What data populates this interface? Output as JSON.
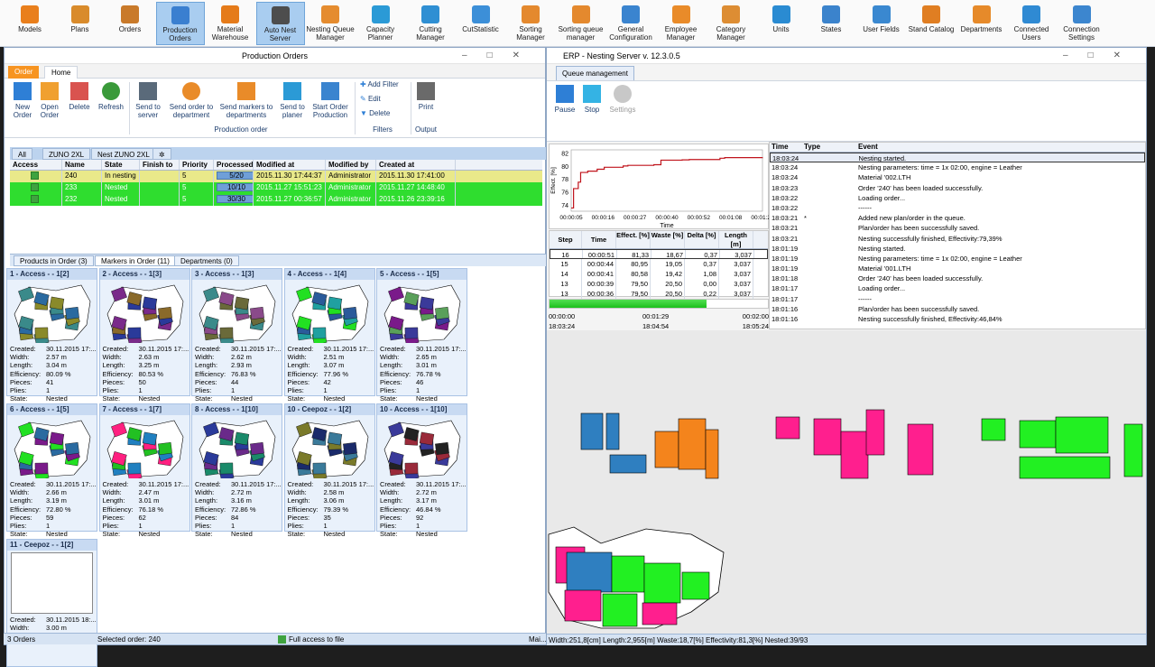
{
  "toolbar": {
    "items": [
      {
        "label": "Models",
        "color": "#e97f1c"
      },
      {
        "label": "Plans",
        "color": "#d98b2b"
      },
      {
        "label": "Orders",
        "color": "#c97a2a"
      },
      {
        "label": "Production Orders",
        "color": "#3a7fd0",
        "active": true
      },
      {
        "label": "Material Warehouse",
        "color": "#e57b1a"
      },
      {
        "label": "Auto Nest Server",
        "color": "#4d4d4d",
        "active": true
      },
      {
        "label": "Nesting Queue Manager",
        "color": "#e58c2f"
      },
      {
        "label": "Capacity Planner",
        "color": "#2b9ad6"
      },
      {
        "label": "Cutting Manager",
        "color": "#2f8fd3"
      },
      {
        "label": "CutStatistic",
        "color": "#3c8fd8"
      },
      {
        "label": "Sorting Manager",
        "color": "#e4892e"
      },
      {
        "label": "Sorting queue manager",
        "color": "#e4892e"
      },
      {
        "label": "General Configuration",
        "color": "#3a84cf"
      },
      {
        "label": "Employee Manager",
        "color": "#e98b29"
      },
      {
        "label": "Category Manager",
        "color": "#dd8d33"
      },
      {
        "label": "Units",
        "color": "#2a8bd2"
      },
      {
        "label": "States",
        "color": "#3b83cc"
      },
      {
        "label": "User Fields",
        "color": "#3a88d0"
      },
      {
        "label": "Stand Catalog",
        "color": "#e07e22"
      },
      {
        "label": "Departments",
        "color": "#e68a2a"
      },
      {
        "label": "Connected Users",
        "color": "#2f8ad3"
      },
      {
        "label": "Connection Settings",
        "color": "#3c86cf"
      }
    ]
  },
  "win1": {
    "title": "Production Orders",
    "tab_order": "Order",
    "tab_home": "Home",
    "ribbon": {
      "new": "New Order",
      "open": "Open Order",
      "delete": "Delete",
      "refresh": "Refresh",
      "send_server": "Send to server",
      "send_dept": "Send order to department",
      "send_markers": "Send markers to departments",
      "send_planer": "Send to planer",
      "start": "Start Order Production",
      "group_po": "Production order",
      "add_filter": "Add Filter",
      "edit": "Edit",
      "delete_f": "Delete",
      "group_filters": "Filters",
      "print": "Print",
      "group_output": "Output"
    },
    "grid_tabs": [
      "All",
      "ZUNO 2XL",
      "Nest ZUNO 2XL"
    ],
    "headers": [
      "Access",
      "Name",
      "State",
      "Finish to",
      "Priority",
      "Processed",
      "Modified at",
      "Modified by",
      "Created at"
    ],
    "rows": [
      {
        "name": "240",
        "state": "In nesting",
        "finish": "",
        "priority": "5",
        "processed": "5/20",
        "modified": "2015.11.30 17:44:37",
        "by": "Administrator",
        "created": "2015.11.30 17:41:00",
        "style": "sel"
      },
      {
        "name": "233",
        "state": "Nested",
        "finish": "",
        "priority": "5",
        "processed": "10/10",
        "modified": "2015.11.27 15:51:23",
        "by": "Administrator",
        "created": "2015.11.27 14:48:40",
        "style": "green"
      },
      {
        "name": "232",
        "state": "Nested",
        "finish": "",
        "priority": "5",
        "processed": "30/30",
        "modified": "2015.11.27 00:36:57",
        "by": "Administrator",
        "created": "2015.11.26 23:39:16",
        "style": "green"
      }
    ],
    "sub_tabs": [
      "Products in Order (3)",
      "Markers in Order (11)",
      "Departments (0)"
    ],
    "meta_labels": [
      "Created:",
      "Width:",
      "Length:",
      "Efficiency:",
      "Pieces:",
      "Plies:",
      "State:"
    ],
    "cards": [
      {
        "title": "1 - Access -  - 1[2]",
        "created": "30.11.2015 17:...",
        "width": "2.57 m",
        "length": "3.04 m",
        "eff": "80.09 %",
        "pieces": "41",
        "plies": "1",
        "state": "Nested"
      },
      {
        "title": "2 - Access -  - 1[3]",
        "created": "30.11.2015 17:...",
        "width": "2.63 m",
        "length": "3.25 m",
        "eff": "80.53 %",
        "pieces": "50",
        "plies": "1",
        "state": "Nested"
      },
      {
        "title": "3 - Access -  - 1[3]",
        "created": "30.11.2015 17:...",
        "width": "2.62 m",
        "length": "2.93 m",
        "eff": "76.83 %",
        "pieces": "44",
        "plies": "1",
        "state": "Nested"
      },
      {
        "title": "4 - Access -  - 1[4]",
        "created": "30.11.2015 17:...",
        "width": "2.51 m",
        "length": "3.07 m",
        "eff": "77.96 %",
        "pieces": "42",
        "plies": "1",
        "state": "Nested"
      },
      {
        "title": "5 - Access -  - 1[5]",
        "created": "30.11.2015 17:...",
        "width": "2.65 m",
        "length": "3.01 m",
        "eff": "76.78 %",
        "pieces": "46",
        "plies": "1",
        "state": "Nested"
      },
      {
        "title": "6 - Access -  - 1[5]",
        "created": "30.11.2015 17:...",
        "width": "2.66 m",
        "length": "3.19 m",
        "eff": "72.80 %",
        "pieces": "59",
        "plies": "1",
        "state": "Nested"
      },
      {
        "title": "7 - Access -  - 1[7]",
        "created": "30.11.2015 17:...",
        "width": "2.47 m",
        "length": "3.01 m",
        "eff": "76.18 %",
        "pieces": "62",
        "plies": "1",
        "state": "Nested"
      },
      {
        "title": "8 - Access -  - 1[10]",
        "created": "30.11.2015 17:...",
        "width": "2.72 m",
        "length": "3.16 m",
        "eff": "72.86 %",
        "pieces": "84",
        "plies": "1",
        "state": "Nested"
      },
      {
        "title": "10 - Ceepoz -  - 1[2]",
        "created": "30.11.2015 17:...",
        "width": "2.58 m",
        "length": "3.06 m",
        "eff": "79.39 %",
        "pieces": "35",
        "plies": "1",
        "state": "Nested"
      },
      {
        "title": "10 - Access -  - 1[10]",
        "created": "30.11.2015 17:...",
        "width": "2.72 m",
        "length": "3.17 m",
        "eff": "46.84 %",
        "pieces": "92",
        "plies": "1",
        "state": "Nested"
      },
      {
        "title": "11 - Ceepoz -  - 1[2]",
        "created": "30.11.2015 18:...",
        "width": "3.00 m",
        "length": "3.00 m",
        "eff": "",
        "pieces": "",
        "plies": "",
        "state": ""
      }
    ],
    "status": {
      "count": "3 Orders",
      "selected": "Selected order:  240",
      "access": "Full access to file",
      "right": "Mai..."
    }
  },
  "win2": {
    "title": "ERP - Nesting Server v. 12.3.0.5",
    "tab": "Queue management",
    "ribbon": {
      "pause": "Pause",
      "stop": "Stop",
      "settings": "Settings"
    },
    "chart_data": {
      "type": "line",
      "ylabel": "Effect. [%]",
      "xlabel": "Time",
      "yticks": [
        "82",
        "80",
        "78",
        "76",
        "74"
      ],
      "xticks": [
        "00:00:05",
        "00:00:16",
        "00:00:27",
        "00:00:40",
        "00:00:52",
        "00:01:08",
        "00:01:26"
      ],
      "ylim": [
        73,
        82.5
      ],
      "x": [
        5,
        6,
        8,
        9,
        12,
        16,
        19,
        27,
        29,
        40,
        43,
        52,
        55,
        56,
        68,
        70,
        86
      ],
      "y": [
        73.5,
        76.5,
        77.5,
        79,
        79.2,
        79.5,
        79.8,
        80,
        80.1,
        80.2,
        80.9,
        80.95,
        81,
        81,
        81.2,
        81.3,
        81.33
      ]
    },
    "step_headers": [
      "Step",
      "Time",
      "Effect. [%]",
      "Waste [%]",
      "Delta [%]",
      "Length [m]"
    ],
    "steps": [
      {
        "step": "16",
        "time": "00:00:51",
        "eff": "81,33",
        "waste": "18,67",
        "delta": "0,37",
        "len": "3,037"
      },
      {
        "step": "15",
        "time": "00:00:44",
        "eff": "80,95",
        "waste": "19,05",
        "delta": "0,37",
        "len": "3,037"
      },
      {
        "step": "14",
        "time": "00:00:41",
        "eff": "80,58",
        "waste": "19,42",
        "delta": "1,08",
        "len": "3,037"
      },
      {
        "step": "13",
        "time": "00:00:39",
        "eff": "79,50",
        "waste": "20,50",
        "delta": "0,00",
        "len": "3,037"
      },
      {
        "step": "13",
        "time": "00:00:36",
        "eff": "79,50",
        "waste": "20,50",
        "delta": "0,22",
        "len": "3,037"
      }
    ],
    "progress": 0.72,
    "times": {
      "t0": "00:00:00",
      "t1": "00:01:29",
      "t2": "00:02:00",
      "c0": "18:03:24",
      "c1": "18:04:54",
      "c2": "18:05:24"
    },
    "log_headers": [
      "Time",
      "Type",
      "Event"
    ],
    "log": [
      {
        "t": "18:03:24",
        "type": "",
        "e": "Nesting started."
      },
      {
        "t": "18:03:24",
        "type": "",
        "e": "Nesting parameters: time = 1x 02:00, engine = Leather"
      },
      {
        "t": "18:03:24",
        "type": "",
        "e": "Material '002.LTH"
      },
      {
        "t": "18:03:23",
        "type": "",
        "e": "Order '240' has been loaded successfully."
      },
      {
        "t": "18:03:22",
        "type": "",
        "e": "Loading order..."
      },
      {
        "t": "18:03:22",
        "type": "",
        "e": "------"
      },
      {
        "t": "18:03:21",
        "type": "*",
        "e": "Added new plan/order in the queue."
      },
      {
        "t": "18:03:21",
        "type": "",
        "e": "Plan/order has been successfully saved."
      },
      {
        "t": "18:03:21",
        "type": "",
        "e": "Nesting successfully finished, Effectivity:79,39%"
      },
      {
        "t": "18:01:19",
        "type": "",
        "e": "Nesting started."
      },
      {
        "t": "18:01:19",
        "type": "",
        "e": "Nesting parameters: time = 1x 02:00, engine = Leather"
      },
      {
        "t": "18:01:19",
        "type": "",
        "e": "Material '001.LTH"
      },
      {
        "t": "18:01:18",
        "type": "",
        "e": "Order '240' has been loaded successfully."
      },
      {
        "t": "18:01:17",
        "type": "",
        "e": "Loading order..."
      },
      {
        "t": "18:01:17",
        "type": "",
        "e": "------"
      },
      {
        "t": "18:01:16",
        "type": "",
        "e": "Plan/order has been successfully saved."
      },
      {
        "t": "18:01:16",
        "type": "",
        "e": "Nesting successfully finished, Effectivity:46,84%"
      }
    ],
    "status": "Width:251,8[cm]  Length:2,955[m]  Waste:18,7[%]  Effectivity:81,3[%]  Nested:39/93"
  }
}
